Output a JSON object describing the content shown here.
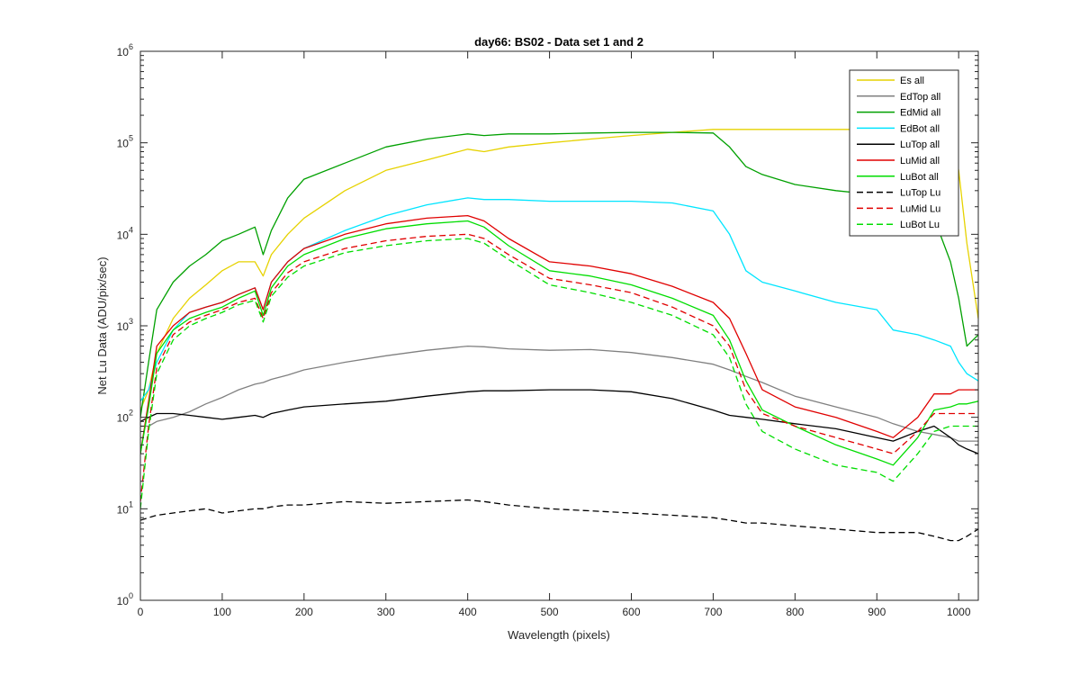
{
  "chart_data": {
    "type": "line",
    "title": "day66: BS02 - Data set 1 and 2",
    "xlabel": "Wavelength (pixels)",
    "ylabel": "Net Lu Data (ADU/pix/sec)",
    "xlim": [
      0,
      1024
    ],
    "ylim": [
      1,
      1000000
    ],
    "yscale": "log",
    "xticks": [
      0,
      100,
      200,
      300,
      400,
      500,
      600,
      700,
      800,
      900,
      1000
    ],
    "yticks": [
      {
        "base": "10",
        "exp": "0"
      },
      {
        "base": "10",
        "exp": "1"
      },
      {
        "base": "10",
        "exp": "2"
      },
      {
        "base": "10",
        "exp": "3"
      },
      {
        "base": "10",
        "exp": "4"
      },
      {
        "base": "10",
        "exp": "5"
      },
      {
        "base": "10",
        "exp": "6"
      }
    ],
    "grid": false,
    "legend_position": "top-right",
    "x": [
      0,
      10,
      20,
      40,
      60,
      80,
      100,
      120,
      140,
      150,
      160,
      180,
      200,
      250,
      300,
      350,
      400,
      420,
      450,
      500,
      550,
      600,
      650,
      700,
      720,
      740,
      760,
      800,
      850,
      900,
      920,
      950,
      970,
      990,
      1000,
      1010,
      1024
    ],
    "series": [
      {
        "name": "Es  all",
        "color": "#e6d200",
        "dash": "",
        "values": [
          120,
          200,
          500,
          1200,
          2000,
          2800,
          4000,
          5000,
          5000,
          3500,
          6000,
          10000,
          15000,
          30000,
          50000,
          65000,
          85000,
          80000,
          90000,
          100000,
          110000,
          120000,
          130000,
          140000,
          140000,
          140000,
          140000,
          140000,
          140000,
          140000,
          140000,
          140000,
          140000,
          140000,
          50000,
          8000,
          1200
        ]
      },
      {
        "name": "EdTop  all",
        "color": "#808080",
        "dash": "",
        "values": [
          80,
          80,
          90,
          100,
          115,
          140,
          165,
          200,
          230,
          240,
          260,
          290,
          330,
          400,
          470,
          540,
          600,
          590,
          560,
          540,
          550,
          510,
          450,
          380,
          330,
          280,
          240,
          170,
          130,
          100,
          85,
          70,
          65,
          60,
          55,
          55,
          55
        ]
      },
      {
        "name": "EdMid  all",
        "color": "#00a000",
        "dash": "",
        "values": [
          100,
          400,
          1500,
          3000,
          4500,
          6000,
          8500,
          10000,
          12000,
          6000,
          11000,
          25000,
          40000,
          60000,
          90000,
          110000,
          125000,
          120000,
          125000,
          125000,
          128000,
          130000,
          130000,
          128000,
          90000,
          55000,
          45000,
          35000,
          30000,
          27000,
          25000,
          22000,
          15000,
          5000,
          2000,
          600,
          800
        ]
      },
      {
        "name": "EdBot  all",
        "color": "#00e5ff",
        "dash": "",
        "values": [
          150,
          200,
          400,
          900,
          1400,
          1600,
          1800,
          2200,
          2600,
          1500,
          3000,
          5000,
          7000,
          11000,
          16000,
          21000,
          25000,
          24000,
          24000,
          23000,
          23000,
          23000,
          22000,
          18000,
          10000,
          4000,
          3000,
          2400,
          1800,
          1500,
          900,
          800,
          700,
          600,
          400,
          300,
          250
        ]
      },
      {
        "name": "LuTop  all",
        "color": "#000000",
        "dash": "",
        "values": [
          90,
          100,
          110,
          110,
          105,
          100,
          95,
          100,
          105,
          100,
          110,
          120,
          130,
          140,
          150,
          170,
          190,
          195,
          195,
          200,
          200,
          190,
          160,
          120,
          105,
          100,
          95,
          85,
          75,
          60,
          55,
          70,
          80,
          60,
          50,
          45,
          40
        ]
      },
      {
        "name": "LuMid  all",
        "color": "#e00000",
        "dash": "",
        "values": [
          40,
          150,
          600,
          1000,
          1400,
          1600,
          1800,
          2200,
          2600,
          1500,
          3000,
          5000,
          7000,
          10000,
          13000,
          15000,
          16000,
          14000,
          9000,
          5000,
          4500,
          3700,
          2700,
          1800,
          1200,
          500,
          200,
          130,
          100,
          70,
          60,
          100,
          180,
          180,
          200,
          200,
          200
        ]
      },
      {
        "name": "LuBot  all",
        "color": "#00dd00",
        "dash": "",
        "values": [
          40,
          130,
          500,
          900,
          1200,
          1400,
          1600,
          2000,
          2400,
          1300,
          2600,
          4500,
          6000,
          9000,
          11500,
          13000,
          14000,
          12000,
          7500,
          4000,
          3500,
          2800,
          2000,
          1300,
          700,
          250,
          120,
          80,
          50,
          35,
          30,
          60,
          120,
          130,
          140,
          140,
          150
        ]
      },
      {
        "name": "LuTop  Lu",
        "color": "#000000",
        "dash": "7 4",
        "values": [
          7.5,
          8,
          8.5,
          9,
          9.5,
          10,
          9,
          9.5,
          10,
          10,
          10.5,
          11,
          11,
          12,
          11.5,
          12,
          12.5,
          12,
          11,
          10,
          9.5,
          9,
          8.5,
          8,
          7.5,
          7,
          7,
          6.5,
          6,
          5.5,
          5.5,
          5.5,
          5,
          4.5,
          4.5,
          5,
          6
        ]
      },
      {
        "name": "LuMid  Lu",
        "color": "#e00000",
        "dash": "7 4",
        "values": [
          12,
          80,
          350,
          800,
          1100,
          1300,
          1500,
          1800,
          2000,
          1200,
          2300,
          3800,
          5000,
          7000,
          8500,
          9500,
          10000,
          9000,
          6000,
          3300,
          2800,
          2300,
          1600,
          1000,
          600,
          200,
          110,
          80,
          60,
          45,
          40,
          70,
          110,
          110,
          110,
          110,
          110
        ]
      },
      {
        "name": "LuBot  Lu",
        "color": "#00dd00",
        "dash": "7 4",
        "values": [
          10,
          70,
          300,
          700,
          1000,
          1200,
          1400,
          1700,
          1900,
          1100,
          2100,
          3400,
          4500,
          6300,
          7500,
          8500,
          9000,
          8000,
          5300,
          2800,
          2300,
          1800,
          1300,
          800,
          450,
          140,
          70,
          45,
          30,
          25,
          20,
          40,
          70,
          80,
          80,
          80,
          80
        ]
      }
    ]
  }
}
